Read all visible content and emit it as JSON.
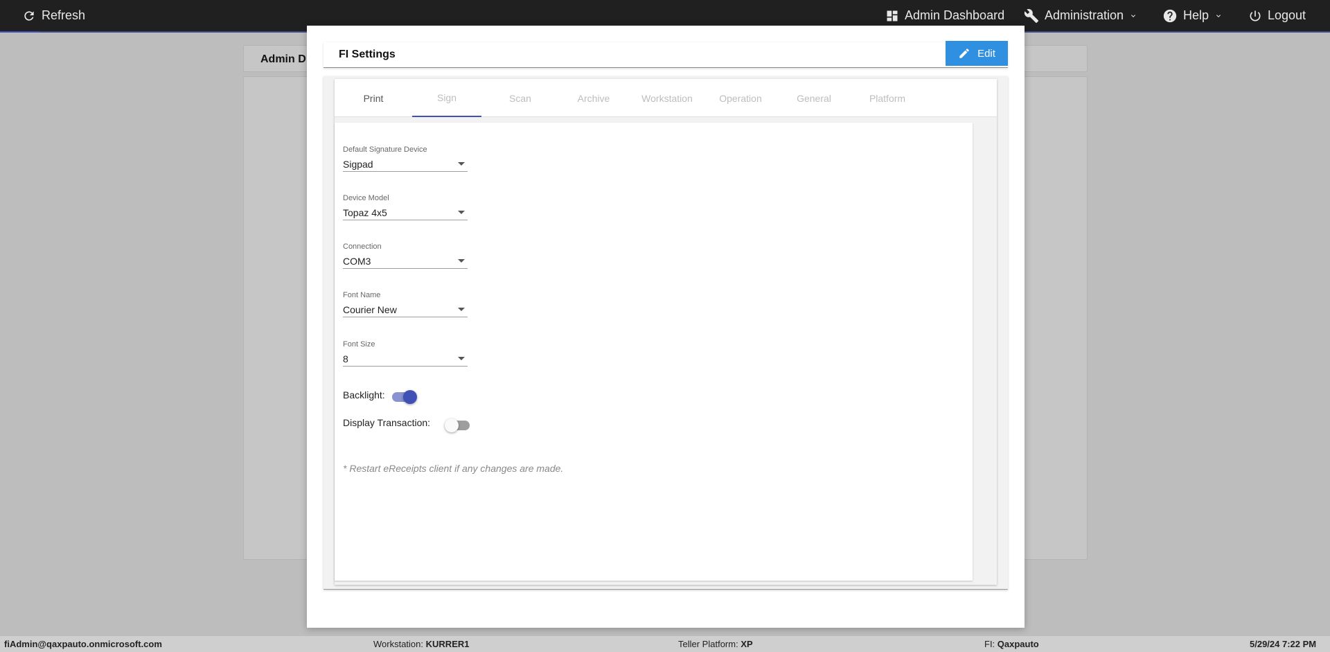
{
  "topbar": {
    "refresh": "Refresh",
    "admin_dashboard": "Admin Dashboard",
    "administration": "Administration",
    "help": "Help",
    "logout": "Logout"
  },
  "background": {
    "card_title": "Admin D"
  },
  "modal": {
    "title": "FI Settings",
    "edit_label": "Edit",
    "tabs": [
      "Print",
      "Sign",
      "Scan",
      "Archive",
      "Workstation",
      "Operation",
      "General",
      "Platform"
    ],
    "active_tab": "Sign",
    "fields": [
      {
        "label": "Default Signature Device",
        "value": "Sigpad"
      },
      {
        "label": "Device Model",
        "value": "Topaz 4x5"
      },
      {
        "label": "Connection",
        "value": "COM3"
      },
      {
        "label": "Font Name",
        "value": "Courier New"
      },
      {
        "label": "Font Size",
        "value": "8"
      }
    ],
    "toggles": [
      {
        "label": "Backlight:",
        "on": true
      },
      {
        "label": "Display Transaction:",
        "on": false
      }
    ],
    "note": "* Restart eReceipts client if any changes are made."
  },
  "statusbar": {
    "user": "fiAdmin@qaxpauto.onmicrosoft.com",
    "workstation_label": "Workstation:",
    "workstation_value": "KURRER1",
    "teller_label": "Teller Platform:",
    "teller_value": "XP",
    "fi_label": "FI:",
    "fi_value": "Qaxpauto",
    "datetime": "5/29/24 7:22 PM"
  },
  "colors": {
    "accent": "#3f51b5",
    "edit_button": "#2f8fe0",
    "topbar": "#202020"
  }
}
